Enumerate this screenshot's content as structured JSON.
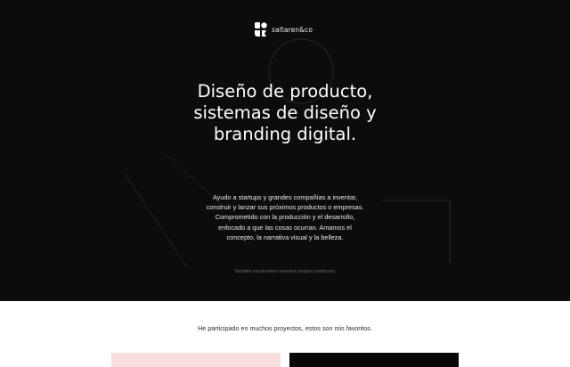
{
  "brand": {
    "name": "saltaren&co",
    "logo_icon": "brand-mark-icon"
  },
  "hero": {
    "headline_lines": [
      "Diseño de producto,",
      "sistemas de diseño y",
      "branding digital."
    ],
    "intro_lines": [
      "Ayudo a startups y grandes compañías a inventar,",
      "construir y lanzar sus próximos productos o empresas.",
      "Comprometido con la producción y el desarrollo,",
      "enfocado a que las cosas ocurran. Amamos el",
      "concepto, la narrativa visual y la belleza."
    ],
    "footnote": "También construimos nuestros propios productos.",
    "background_color": "#0c0c0c"
  },
  "projects": {
    "heading": "He participado en muchos proyectos, estos son mis favoritos.",
    "cards": [
      {
        "color": "#f9dede"
      },
      {
        "color": "#070707"
      }
    ]
  }
}
